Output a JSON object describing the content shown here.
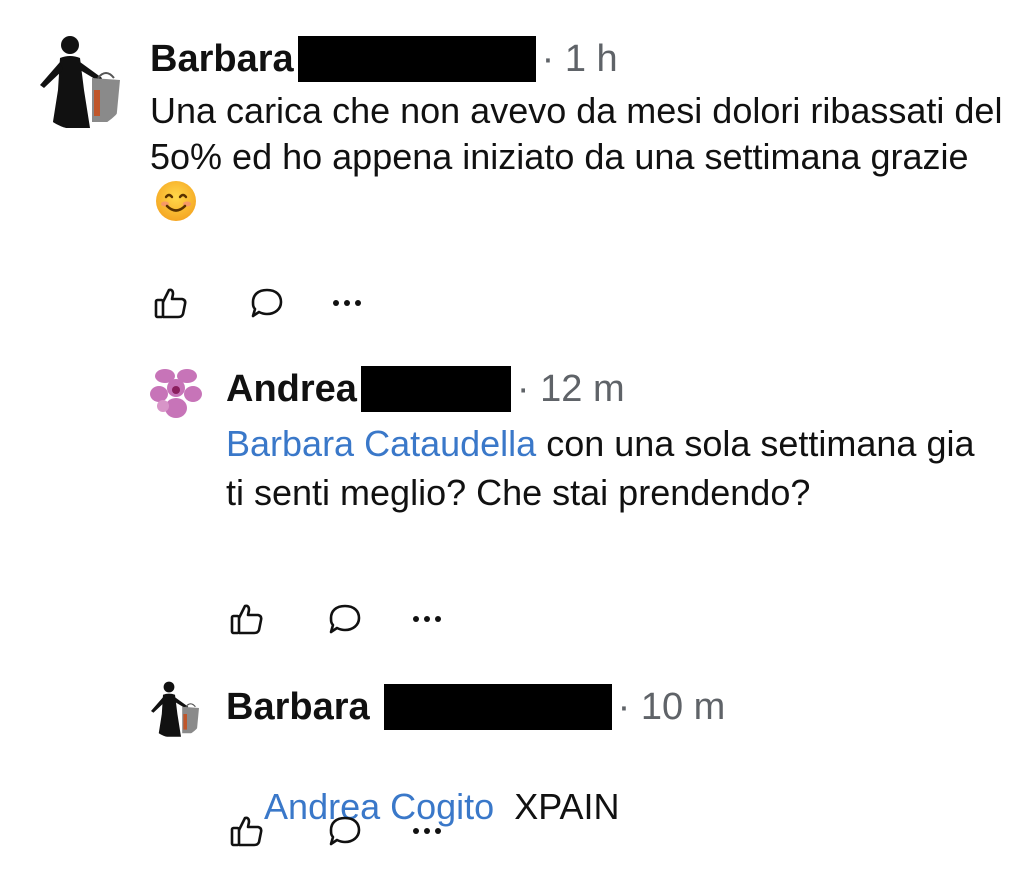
{
  "comments": [
    {
      "author": "Barbara",
      "time": "· 1 h",
      "text": "Una carica che non avevo da mesi dolori ribassati del 5o% ed ho appena iniziato da una settimana grazie",
      "emoji_icon": "smiling-face-emoji"
    },
    {
      "author": "Andrea",
      "time": "· 12 m",
      "mention": "Barbara Cataudella",
      "text": " con una sola settimana gia ti senti meglio? Che stai prendendo?"
    },
    {
      "author": "Barbara",
      "time": "· 10 m",
      "mention": "Andrea Cogito",
      "text": "  XPAIN"
    }
  ],
  "icons": {
    "like": "thumbs-up-icon",
    "reply": "speech-bubble-icon",
    "more": "more-dots-icon"
  },
  "colors": {
    "mention": "#3a78c9",
    "meta": "#5f6368",
    "redaction": "#000000"
  }
}
